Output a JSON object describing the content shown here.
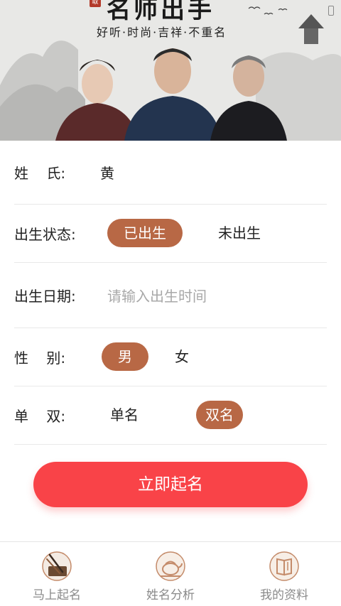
{
  "banner": {
    "title": "名师出手",
    "subtitle": "好听·时尚·吉祥·不重名",
    "seal": "取"
  },
  "form": {
    "surname": {
      "label": "姓    氏:",
      "value": "黄"
    },
    "birth_status": {
      "label": "出生状态:",
      "options": [
        "已出生",
        "未出生"
      ],
      "selected": "已出生"
    },
    "birth_date": {
      "label": "出生日期:",
      "placeholder": "请输入出生时间"
    },
    "gender": {
      "label": "性    别:",
      "options": [
        "男",
        "女"
      ],
      "selected": "男"
    },
    "name_length": {
      "label": "单    双:",
      "options": [
        "单名",
        "双名"
      ],
      "selected": "双名"
    }
  },
  "submit_label": "立即起名",
  "bottom_nav": {
    "items": [
      {
        "label": "马上起名",
        "icon": "brush-icon",
        "active": true
      },
      {
        "label": "姓名分析",
        "icon": "teapot-icon",
        "active": false
      },
      {
        "label": "我的资料",
        "icon": "book-icon",
        "active": false
      }
    ]
  },
  "colors": {
    "accent": "#b86845",
    "button": "#f94348",
    "divider": "#e9e9e9",
    "placeholder": "#a8a8a8"
  }
}
